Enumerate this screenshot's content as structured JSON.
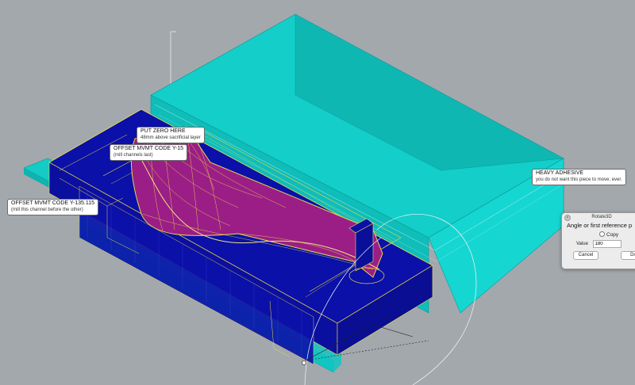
{
  "colors": {
    "background": "#a3a8ad",
    "turquoise": "#11c9c5",
    "blue": "#0a0fa6",
    "magenta": "#9a1d86",
    "wire": "#e8d94a"
  },
  "annotations": {
    "zero": {
      "title": "PUT ZERO HERE",
      "note": "48mm above sacrificial layer"
    },
    "offset15": {
      "title": "OFFSET MVMT CODE Y-15",
      "note": "(mill channels last)"
    },
    "offset135": {
      "title": "OFFSET MVMT CODE Y-135.115",
      "note": "(mill this channel before the other)"
    },
    "adhesive": {
      "title": "HEAVY ADHESIVE",
      "note": "you do not want this piece to move, ever."
    }
  },
  "dialog": {
    "title": "Rotate3D",
    "prompt": "Angle or first reference p",
    "copy_label": "Copy",
    "value_label": "Value",
    "value": "180",
    "cancel_label": "Cancel",
    "ok_label": "Do",
    "close_glyph": "×"
  }
}
